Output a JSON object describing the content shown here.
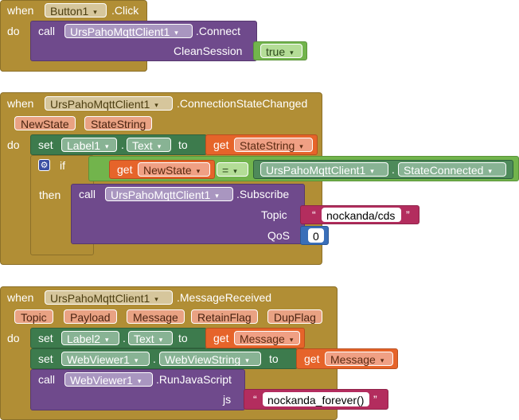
{
  "block1": {
    "when": "when",
    "component": "Button1",
    "event": ".Click",
    "do": "do",
    "call": "call",
    "client": "UrsPahoMqttClient1",
    "method": ".Connect",
    "arg_label": "CleanSession",
    "arg_value": "true"
  },
  "block2": {
    "when": "when",
    "component": "UrsPahoMqttClient1",
    "event": ".ConnectionStateChanged",
    "params": [
      "NewState",
      "StateString"
    ],
    "do": "do",
    "set": "set",
    "set_component": "Label1",
    "set_dot": ".",
    "set_prop": "Text",
    "to": "to",
    "get": "get",
    "get_var": "StateString",
    "if": "if",
    "cond_get": "get",
    "cond_var": "NewState",
    "op": "=",
    "const_component": "UrsPahoMqttClient1",
    "const_dot": ".",
    "const_prop": "StateConnected",
    "then": "then",
    "call": "call",
    "call_component": "UrsPahoMqttClient1",
    "call_method": ".Subscribe",
    "topic_label": "Topic",
    "topic_value": "nockanda/cds",
    "qos_label": "QoS",
    "qos_value": "0"
  },
  "block3": {
    "when": "when",
    "component": "UrsPahoMqttClient1",
    "event": ".MessageReceived",
    "params": [
      "Topic",
      "Payload",
      "Message",
      "RetainFlag",
      "DupFlag"
    ],
    "do": "do",
    "set1": "set",
    "set1_component": "Label2",
    "set1_dot": ".",
    "set1_prop": "Text",
    "to1": "to",
    "get1": "get",
    "get1_var": "Message",
    "set2": "set",
    "set2_component": "WebViewer1",
    "set2_dot": ".",
    "set2_prop": "WebViewString",
    "to2": "to",
    "get2": "get",
    "get2_var": "Message",
    "call": "call",
    "call_component": "WebViewer1",
    "call_method": ".RunJavaScript",
    "js_label": "js",
    "js_value": "nockanda_forever()"
  },
  "symbols": {
    "dropdown": "▾",
    "quote_open": "“",
    "quote_close": "”",
    "gear": "⚙"
  },
  "colors": {
    "event": "#b18e35",
    "call": "#6f4a8c",
    "set": "#3d7b4d",
    "get": "#e6642a",
    "logic": "#72b44c",
    "text": "#b32d5e",
    "math": "#3a6fb9"
  }
}
